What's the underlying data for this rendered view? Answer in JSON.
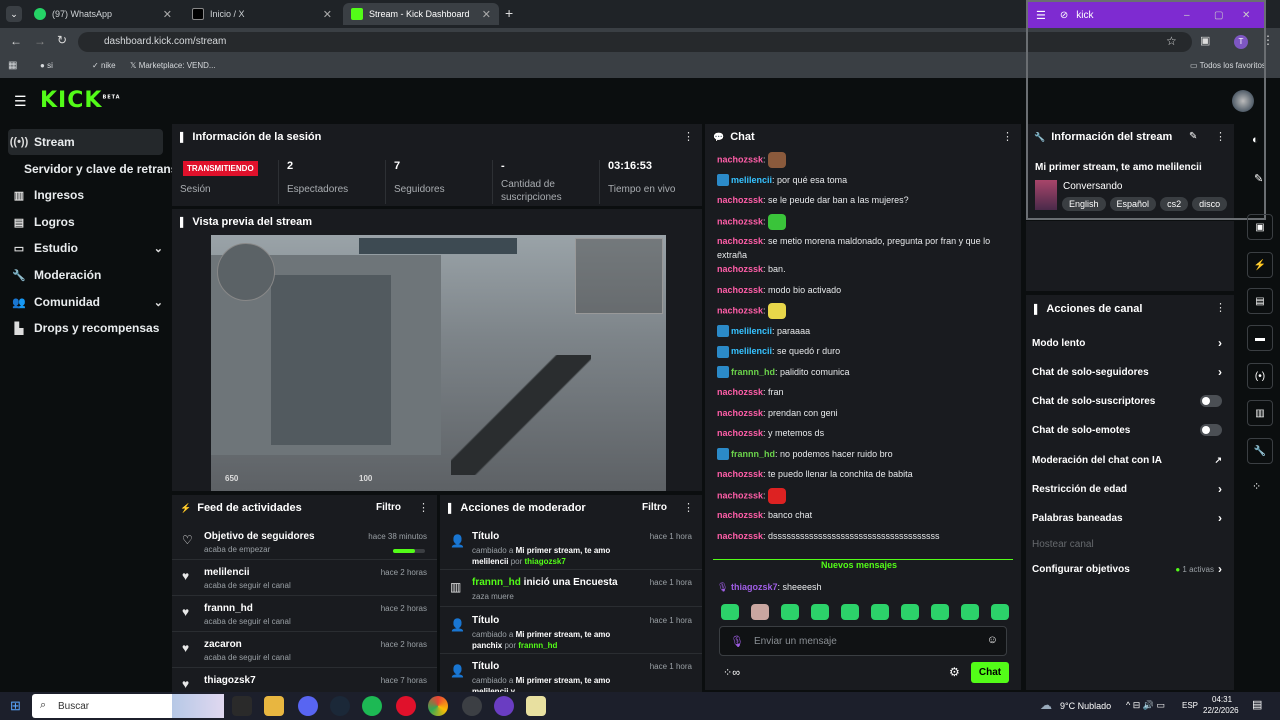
{
  "browser": {
    "tabs": [
      {
        "label": "(97) WhatsApp",
        "icon": "whatsapp-icon"
      },
      {
        "label": "Inicio / X",
        "icon": "x-icon"
      },
      {
        "label": "Stream - Kick Dashboard",
        "icon": "kick-icon"
      }
    ],
    "url": "dashboard.kick.com/stream",
    "bookmarks": [
      "si",
      "nike",
      "Marketplace: VEND...",
      "Todos los favoritos"
    ]
  },
  "popup": {
    "title": "kick"
  },
  "brand": {
    "logo": "KICK",
    "beta": "BETA"
  },
  "sidebar": {
    "items": [
      {
        "label": "Stream",
        "icon": "broadcast-icon"
      },
      {
        "label": "Servidor y clave de retransm",
        "icon": ""
      },
      {
        "label": "Ingresos",
        "icon": "chart-icon"
      },
      {
        "label": "Logros",
        "icon": "trophy-icon"
      },
      {
        "label": "Estudio",
        "icon": "studio-icon"
      },
      {
        "label": "Moderación",
        "icon": "wrench-icon"
      },
      {
        "label": "Comunidad",
        "icon": "community-icon"
      },
      {
        "label": "Drops y recompensas",
        "icon": "drops-icon"
      }
    ]
  },
  "session": {
    "title": "Información de la sesión",
    "live_badge": "TRANSMITIENDO",
    "stats": [
      {
        "value": "",
        "label": "Sesión"
      },
      {
        "value": "2",
        "label": "Espectadores"
      },
      {
        "value": "7",
        "label": "Seguidores"
      },
      {
        "value": "-",
        "label": "Cantidad de suscripciones"
      },
      {
        "value": "03:16:53",
        "label": "Tiempo en vivo"
      }
    ]
  },
  "preview": {
    "title": "Vista previa del stream",
    "hud_health": "650",
    "hud_ammo": "100"
  },
  "feed": {
    "title": "Feed de actividades",
    "filter": "Filtro",
    "items": [
      {
        "name": "Objetivo de seguidores",
        "sub": "acaba de empezar",
        "time": "hace 38 minutos",
        "progress": 0.7
      },
      {
        "name": "melilencii",
        "sub": "acaba de seguir el canal",
        "time": "hace 2 horas"
      },
      {
        "name": "frannn_hd",
        "sub": "acaba de seguir el canal",
        "time": "hace 2 horas"
      },
      {
        "name": "zacaron",
        "sub": "acaba de seguir el canal",
        "time": "hace 2 horas"
      },
      {
        "name": "thiagozsk7",
        "sub": "",
        "time": "hace 7 horas"
      }
    ]
  },
  "mod": {
    "title": "Acciones de moderador",
    "filter": "Filtro",
    "items": [
      {
        "title": "Título",
        "pre": "cambiado a ",
        "bold": "Mi primer stream, te amo melilencii",
        "mid": " por ",
        "user": "thiagozsk7",
        "time": "hace 1 hora"
      },
      {
        "title": "",
        "user_title": "frannn_hd",
        "rest_title": " inició una Encuesta",
        "sub": "zaza muere",
        "time": "hace 1 hora"
      },
      {
        "title": "Título",
        "pre": "cambiado a ",
        "bold": "Mi primer stream, te amo panchix",
        "mid": " por ",
        "user": "frannn_hd",
        "time": "hace 1 hora"
      },
      {
        "title": "Título",
        "pre": "cambiado a ",
        "bold": "Mi primer stream, te amo melilencii y",
        "mid": "",
        "user": "",
        "time": "hace 1 hora"
      }
    ]
  },
  "chat": {
    "title": "Chat",
    "messages": [
      {
        "user": "nachozssk",
        "color": "pink",
        "text": "",
        "emote": "#8a5a3c"
      },
      {
        "user": "melilencii",
        "color": "teal",
        "badge": true,
        "text": "por qué esa toma"
      },
      {
        "user": "nachozssk",
        "color": "pink",
        "text": "se le peude dar ban a las mujeres?"
      },
      {
        "user": "nachozssk",
        "color": "pink",
        "text": "",
        "emote": "#3ac43a"
      },
      {
        "user": "nachozssk",
        "color": "pink",
        "text": "se metio morena maldonado, pregunta por fran y que lo extraña",
        "wrap": true
      },
      {
        "user": "nachozssk",
        "color": "pink",
        "text": "ban."
      },
      {
        "user": "nachozssk",
        "color": "pink",
        "text": "modo bio activado"
      },
      {
        "user": "nachozssk",
        "color": "pink",
        "text": "",
        "emote": "#e8d74a"
      },
      {
        "user": "melilencii",
        "color": "teal",
        "badge": true,
        "text": "paraaaa"
      },
      {
        "user": "melilencii",
        "color": "teal",
        "badge": true,
        "text": "se quedó r duro"
      },
      {
        "user": "frannn_hd",
        "color": "green",
        "badge": true,
        "text": "palidito comunica"
      },
      {
        "user": "nachozssk",
        "color": "pink",
        "text": "fran"
      },
      {
        "user": "nachozssk",
        "color": "pink",
        "text": "prendan con geni"
      },
      {
        "user": "nachozssk",
        "color": "pink",
        "text": "y metemos ds"
      },
      {
        "user": "frannn_hd",
        "color": "green",
        "badge": true,
        "text": "no podemos hacer ruido bro"
      },
      {
        "user": "nachozssk",
        "color": "pink",
        "text": "te puedo llenar la conchita de babita"
      },
      {
        "user": "nachozssk",
        "color": "pink",
        "text": "",
        "emote": "#d22"
      },
      {
        "user": "nachozssk",
        "color": "pink",
        "text": "banco chat"
      },
      {
        "user": "nachozssk",
        "color": "pink",
        "text": "dsssssssssssssssssssssssssssssssssssss"
      }
    ],
    "new_messages": "Nuevos mensajes",
    "last": {
      "user": "thiagozsk7",
      "text": "sheeeesh"
    },
    "input_placeholder": "Enviar un mensaje",
    "send": "Chat"
  },
  "stream_info": {
    "title": "Información del stream",
    "stream_title": "Mi primer stream, te amo melilencii",
    "category": "Conversando",
    "tags": [
      "English",
      "Español",
      "cs2",
      "disco"
    ]
  },
  "channel_actions": {
    "title": "Acciones de canal",
    "rows": [
      {
        "label": "Modo lento",
        "control": "chevron"
      },
      {
        "label": "Chat de solo-seguidores",
        "control": "chevron"
      },
      {
        "label": "Chat de solo-suscriptores",
        "control": "toggle"
      },
      {
        "label": "Chat de solo-emotes",
        "control": "toggle"
      },
      {
        "label": "Moderación del chat con IA",
        "control": "external"
      },
      {
        "label": "Restricción de edad",
        "control": "chevron"
      },
      {
        "label": "Palabras baneadas",
        "control": "chevron"
      },
      {
        "label": "Hostear canal",
        "control": "none",
        "disabled": true
      },
      {
        "label": "Configurar objetivos",
        "control": "chevron",
        "extra": "1 activas"
      }
    ]
  },
  "taskbar": {
    "search": "Buscar",
    "weather": "9°C  Nublado",
    "lang": "ESP",
    "time": "04:31",
    "date": "22/2/2026"
  },
  "colors": {
    "accent": "#53fc18",
    "live": "#e0112b",
    "panel": "#191b1f",
    "bg": "#0b0e0f"
  }
}
